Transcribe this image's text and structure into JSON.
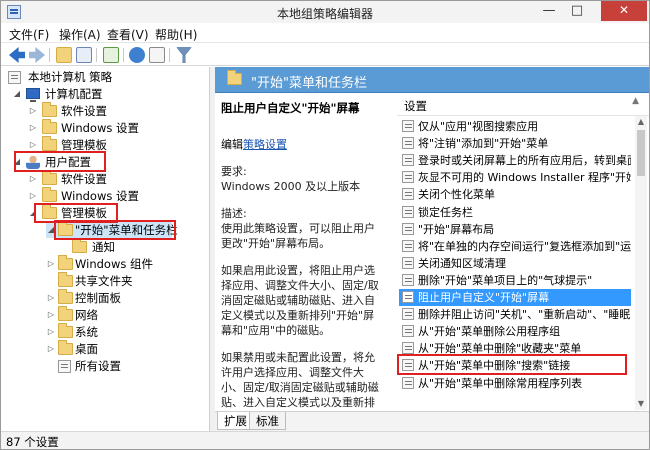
{
  "window": {
    "title": "本地组策略编辑器"
  },
  "menu": [
    "文件(F)",
    "操作(A)",
    "查看(V)",
    "帮助(H)"
  ],
  "toolbar": [
    "back-icon",
    "forward-icon",
    "up-folder-icon",
    "show-hide-tree-icon",
    "export-list-icon",
    "help-icon",
    "properties-icon",
    "filter-icon"
  ],
  "tree": {
    "root": "本地计算机 策略",
    "computer_config": "计算机配置",
    "cc_software": "软件设置",
    "cc_windows": "Windows 设置",
    "cc_admin": "管理模板",
    "user_config": "用户配置",
    "uc_software": "软件设置",
    "uc_windows": "Windows 设置",
    "uc_admin": "管理模板",
    "start_taskbar": "\"开始\"菜单和任务栏",
    "notify": "通知",
    "win_components": "Windows 组件",
    "shared_folders": "共享文件夹",
    "control_panel": "控制面板",
    "network": "网络",
    "system": "系统",
    "desktop": "桌面",
    "all_settings": "所有设置"
  },
  "right": {
    "header": "\"开始\"菜单和任务栏",
    "desc_title": "阻止用户自定义\"开始\"屏幕",
    "edit_prefix": "编辑",
    "edit_link": "策略设置",
    "req_label": "要求:",
    "req_value": "Windows 2000 及以上版本",
    "desc_label": "描述:",
    "desc_1": "使用此策略设置，可以阻止用户更改\"开始\"屏幕布局。",
    "desc_2": "如果启用此设置，将阻止用户选择应用、调整文件大小、固定/取消固定磁贴或辅助磁贴、进入自定义模式以及重新排列\"开始\"屏幕和\"应用\"中的磁贴。",
    "desc_3": "如果禁用或未配置此设置，将允许用户选择应用、调整文件大小、固定/取消固定磁贴或辅助磁贴、进入自定义模式以及重新排列\"开始\"屏幕和\"应用\"中的磁贴。",
    "list_header": "设置",
    "rows": [
      "仅从\"应用\"视图搜索应用",
      "将\"注销\"添加到\"开始\"菜单",
      "登录时或关闭屏幕上的所有应用后，转到桌面而",
      "灰显不可用的 Windows Installer 程序\"开始\"菜",
      "关闭个性化菜单",
      "锁定任务栏",
      "\"开始\"屏幕布局",
      "将\"在单独的内存空间运行\"复选框添加到\"运行\"对",
      "关闭通知区域清理",
      "删除\"开始\"菜单项目上的\"气球提示\"",
      "阻止用户自定义\"开始\"屏幕",
      "删除并阻止访问\"关机\"、\"重新启动\"、\"睡眠\"和\"",
      "从\"开始\"菜单删除公用程序组",
      "从\"开始\"菜单中删除\"收藏夹\"菜单",
      "从\"开始\"菜单中删除\"搜索\"链接",
      "从\"开始\"菜单中删除常用程序列表"
    ],
    "selected_index": 10,
    "tabs": [
      "扩展",
      "标准"
    ]
  },
  "status": "87 个设置"
}
